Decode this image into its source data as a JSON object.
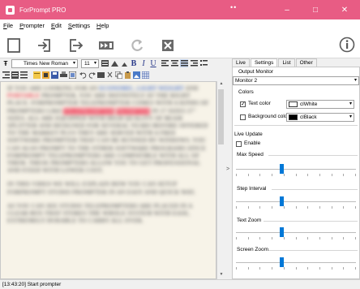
{
  "window": {
    "title": "ForPrompt PRO",
    "title_dots": "••",
    "minimize": "–",
    "maximize": "□",
    "close": "✕",
    "title_color": "#e85c84"
  },
  "menu": {
    "items": [
      "File",
      "Prompter",
      "Edit",
      "Settings",
      "Help"
    ]
  },
  "toolbar": {
    "icons": [
      "new-document-icon",
      "open-file-icon",
      "export-icon",
      "play-icon",
      "refresh-icon",
      "close-icon",
      "info-icon"
    ],
    "info_glyph": "i"
  },
  "format": {
    "font_name": "Times New Roman",
    "font_size": "11",
    "bold": "B",
    "italic": "I",
    "underline": "U",
    "arrow": "▾"
  },
  "editor": {
    "paragraphs": [
      [
        "IF YOU ARE LOOKING FOR AN ",
        "ECONOMIC, LIGHT WEIGHT",
        " AND ",
        "PORTABLE",
        " PROMPTER, YOU ARE DEFINITELY AT THE RIGHT PLACE. FORPROMPTER TELEPROMPTER COMES WITH A KINDS OF PROMPTERS LIKE ",
        "TELEPROMPTER",
        " ",
        "PROMPTER",
        " IN 17 SIZES 17\" SIZES. ALL ARE EQUIPPED WITH HIGH QUALITY OF BEAM SPLITTER AND DESIGNED FOR SEVERAL YEARS BEFORE OFFERED TO THE MARKET PLUS THEY ARE SERVED WITH A FREE SOFTWARE PROMPTER THAT CAN BE RUNNED BY WINDOWS. YOU CAN ALSO PROMPT TO THE OTHER SOFTWARE PROGRAMS SINCE FORPROMPT TELEPROMPTERS ARE COMPATIBLE WITH ALL OF THEM. THESE PROMPTERS ALLOW YOU TO GET PROFESSIONAL AND FIXED WITH LOWER COST."
      ],
      [
        "IN THIS VIDEO WE WILL EXPLAIN HOW YOU CAN SETUP FORPROMPT STUDIO PROMPTER IN AN EASY AND QUICK WAY."
      ],
      [
        "AS YOU CAN SEE STUDIO TELEPROMPTERS ARE PLACED IN A CLEAR BOX THAT STORES THE WHOLE SYSTEM WITH EASE, EXTREMELY DURABLE TO CARRY ALL OVER."
      ]
    ]
  },
  "panel": {
    "tabs": [
      "Live",
      "Settings",
      "List",
      "Other"
    ],
    "output_monitor_label": "Output Monitor",
    "output_monitor_value": "Monitor 2",
    "colors_label": "Colors",
    "text_color_label": "Text color",
    "text_color_value": "clWhite",
    "text_color_swatch": "#ffffff",
    "background_color_label": "Background color",
    "background_color_value": "clBlack",
    "background_color_swatch": "#000000",
    "live_update_label": "Live Update",
    "enable_label": "Enable",
    "max_speed_label": "Max Speed",
    "step_interval_label": "Step Interval",
    "text_zoom_label": "Text Zoom",
    "screen_zoom_label": "Screen Zoom",
    "check_mark": "✓",
    "max_speed_level": 0.38,
    "step_interval_level": 0.38,
    "text_zoom_level": 0.38,
    "screen_zoom_level": 0.38,
    "accent": "#0078d7"
  },
  "splitter": {
    "arrow": ">"
  },
  "status": {
    "text": "[13:43:20] Start prompter"
  }
}
